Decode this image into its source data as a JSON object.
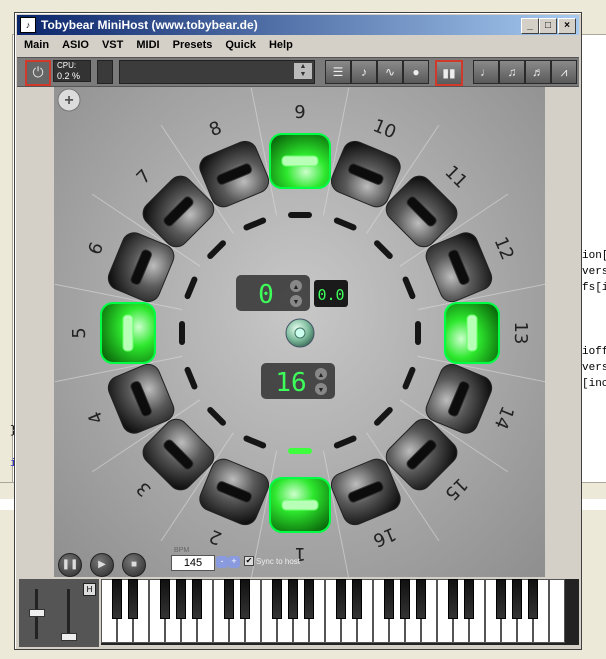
{
  "window": {
    "title": "Tobybear MiniHost (www.tobybear.de)",
    "controls": [
      "_",
      "□",
      "×"
    ]
  },
  "menu": [
    "Main",
    "ASIO",
    "VST",
    "MIDI",
    "Presets",
    "Quick",
    "Help"
  ],
  "toolbar": {
    "cpu_label": "CPU:",
    "cpu_value": "0.2 %",
    "power_icon": "power-icon",
    "tool_icons": [
      "mixer-icon",
      "note-icon",
      "envelope-icon",
      "record-icon",
      "piano-icon",
      "trill-icon",
      "chord-icon",
      "arp-icon",
      "wave-icon"
    ]
  },
  "plugin": {
    "pad_numbers": [
      "1",
      "2",
      "3",
      "4",
      "5",
      "6",
      "7",
      "8",
      "9",
      "10",
      "11",
      "12",
      "13",
      "14",
      "15",
      "16"
    ],
    "active_pads": [
      1,
      5,
      9,
      13
    ],
    "step_display": "0",
    "step_decimal": "0.0",
    "steps_display": "16",
    "add_icon": "plus-icon",
    "center_icon": "target-icon"
  },
  "transport": {
    "pause_icon": "pause-icon",
    "play_icon": "play-icon",
    "stop_icon": "stop-icon",
    "bpm_label": "BPM",
    "bpm_value": "145",
    "bpm_minus": "-",
    "bpm_plus": "+",
    "sync_label": "Sync to host",
    "sync_checked": true
  },
  "keyboard": {
    "hold_label": "H"
  },
  "background": {
    "code_lines": [
      "ion[",
      "vers",
      "fs[i",
      "ioff",
      "vers",
      "[inc"
    ],
    "side_text": [
      "}",
      "i"
    ]
  }
}
